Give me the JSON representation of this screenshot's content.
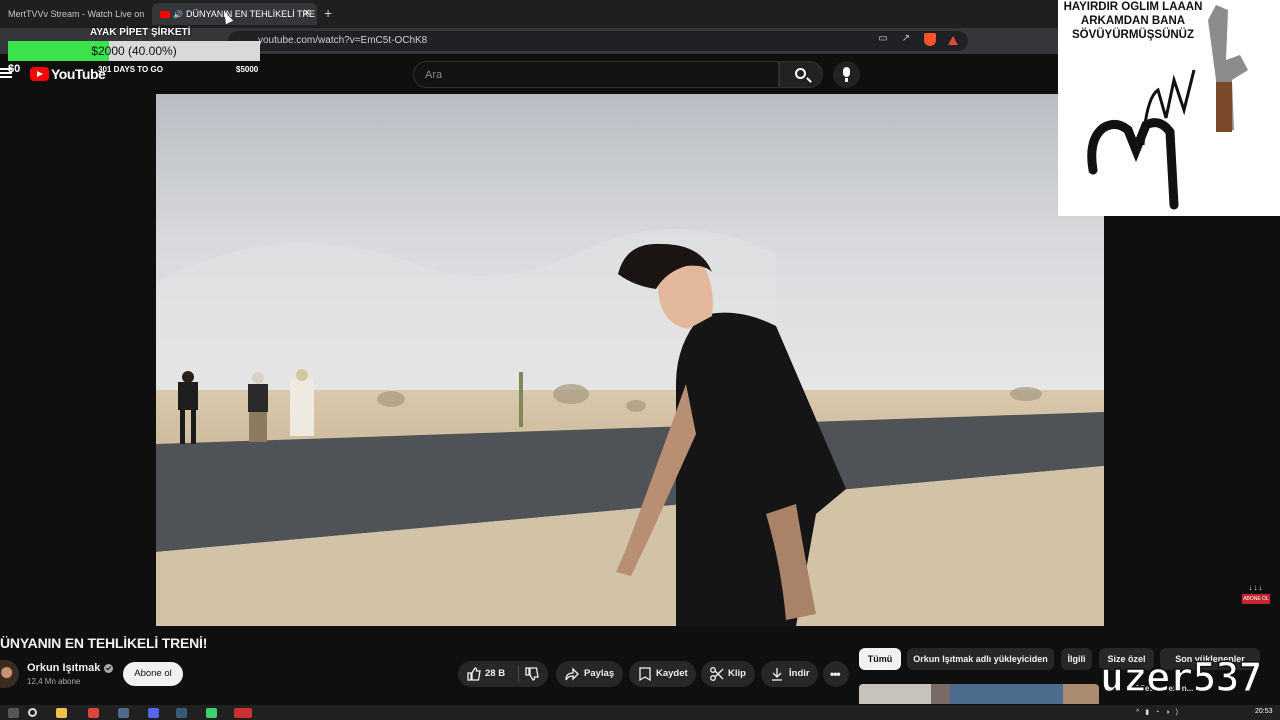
{
  "browser": {
    "tabs": [
      {
        "title": "MertTVVv Stream - Watch Live on Ki",
        "active": false
      },
      {
        "title": "DÜNYANIN EN TEHLİKELİ TRE",
        "active": true,
        "audio": true
      }
    ],
    "url": "youtube.com/watch?v=EmC5t-OChK8"
  },
  "overlay_goal": {
    "title": "AYAK PİPET ŞİRKETİ",
    "amount_text": "$2000 (40.00%)",
    "progress": 0.4,
    "start": "$0",
    "days": "301 DAYS TO GO",
    "end": "$5000",
    "fill_color": "#3be24a"
  },
  "header": {
    "logo_text": "YouTube",
    "search_placeholder": "Ara"
  },
  "meme": {
    "text_line1": "HAYIRDIR OGLIM LAAAN",
    "text_line2": "ARKAMDAN BANA",
    "text_line3": "SÖVÜYÜRMÜŞSÜNÜZ"
  },
  "video": {
    "title": "ÜNYANIN EN TEHLİKELİ TRENİ!",
    "channel": "Orkun Işıtmak",
    "subscribers": "12,4 Mn abone",
    "subscribe_label": "Abone ol",
    "actions": {
      "likes": "28 B",
      "share": "Paylaş",
      "save": "Kaydet",
      "clip": "Klip",
      "download": "İndir"
    }
  },
  "sticker": {
    "arrows": "↓↓↓",
    "text": "ABONE OL"
  },
  "chips": [
    "Tümü",
    "Orkun Işıtmak adlı yükleyiciden",
    "İlgili",
    "Size özel",
    "Son yüklenenler"
  ],
  "recommendation": {
    "title": "...Ailesi - Sezon..."
  },
  "watermark": "uzer537",
  "taskbar": {
    "time": "20:53"
  },
  "colors": {
    "accent": "#ff0000",
    "background": "#0f0f0f",
    "chip_bg": "#272727"
  }
}
